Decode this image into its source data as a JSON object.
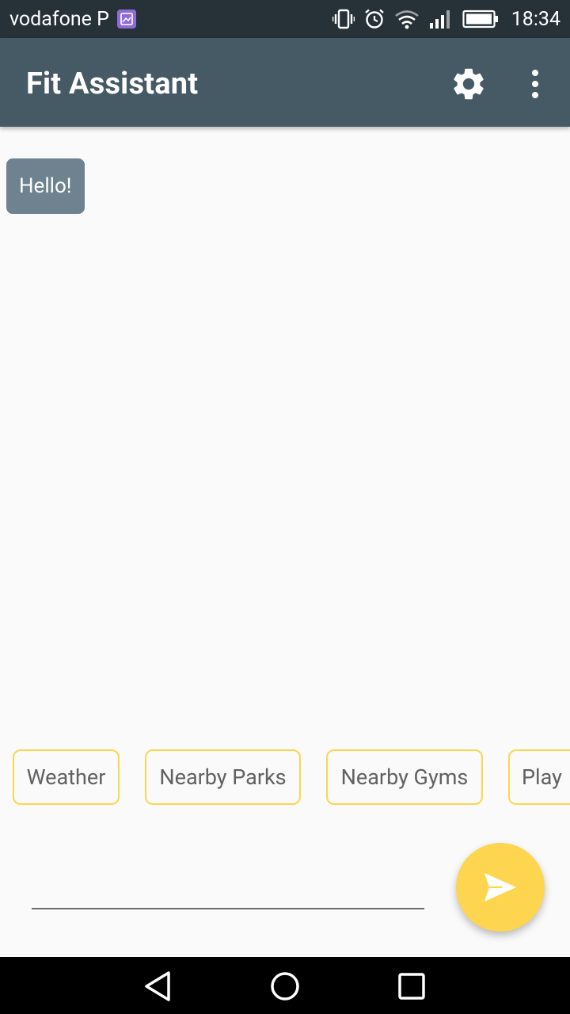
{
  "status_bar": {
    "carrier": "vodafone P",
    "time": "18:34",
    "icons": [
      "gallery-notification-icon",
      "vibrate-icon",
      "alarm-icon",
      "wifi-icon",
      "signal-icon",
      "battery-icon"
    ]
  },
  "app_bar": {
    "title": "Fit Assistant",
    "actions": [
      "settings-icon",
      "more-vert-icon"
    ]
  },
  "chat": {
    "messages": [
      {
        "text": "Hello!"
      }
    ]
  },
  "suggestions": {
    "chips": [
      "Weather",
      "Nearby Parks",
      "Nearby Gyms",
      "Play"
    ]
  },
  "composer": {
    "value": "",
    "placeholder": "",
    "send_icon": "send-icon"
  },
  "nav_bar": {
    "buttons": [
      "back-icon",
      "home-icon",
      "recents-icon"
    ]
  },
  "colors": {
    "status_bar": "#263238",
    "app_bar": "#455a64",
    "bubble": "#6e838f",
    "accent": "#fdd54e",
    "background": "#fafafa"
  }
}
